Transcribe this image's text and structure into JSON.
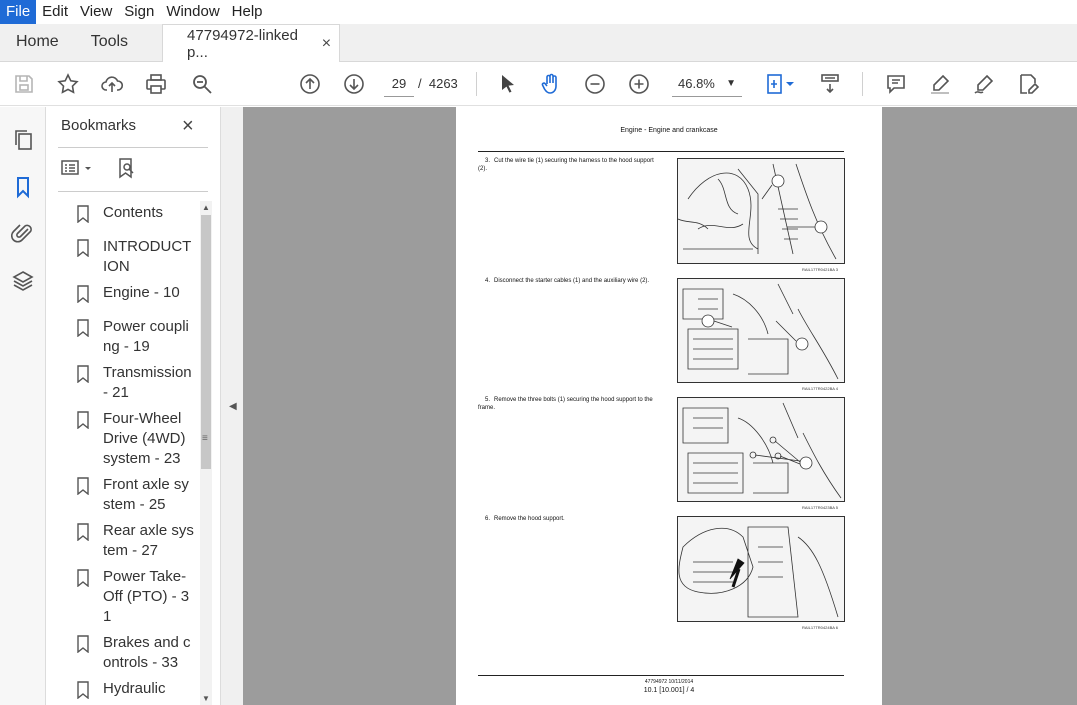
{
  "menu": [
    "File",
    "Edit",
    "View",
    "Sign",
    "Window",
    "Help"
  ],
  "tabs": {
    "home": "Home",
    "tools": "Tools",
    "document": "47794972-linked p...",
    "close": "×"
  },
  "toolbar": {
    "page_current": "29",
    "page_sep": "/",
    "page_total": "4263",
    "zoom": "46.8%"
  },
  "bookmarks": {
    "title": "Bookmarks",
    "close": "×",
    "items": [
      "Contents",
      "INTRODUCTION",
      "Engine - 10",
      "Power coupling - 19",
      "Transmission - 21",
      "Four-Wheel Drive (4WD) system - 23",
      "Front axle system - 25",
      "Rear axle system - 27",
      "Power Take-Off (PTO) - 31",
      "Brakes and controls - 33",
      "Hydraulic"
    ]
  },
  "document": {
    "header": "Engine - Engine and crankcase",
    "steps": [
      {
        "num": "3.",
        "text": "Cut the wire tie (1) securing the harness to the hood support (2).",
        "caption": "RAIL17TR0421BA    3"
      },
      {
        "num": "4.",
        "text": "Disconnect the starter cables (1) and the auxiliary wire (2).",
        "caption": "RAIL17TR0422BA    4"
      },
      {
        "num": "5.",
        "text": "Remove the three bolts (1) securing the hood support to the frame.",
        "caption": "RAIL17TR0423BA    5"
      },
      {
        "num": "6.",
        "text": "Remove the hood support.",
        "caption": "RAIL17TR0424BA    6"
      }
    ],
    "footer_line1": "47794972 10/11/2014",
    "footer_line2": "10.1 [10.001] / 4"
  }
}
